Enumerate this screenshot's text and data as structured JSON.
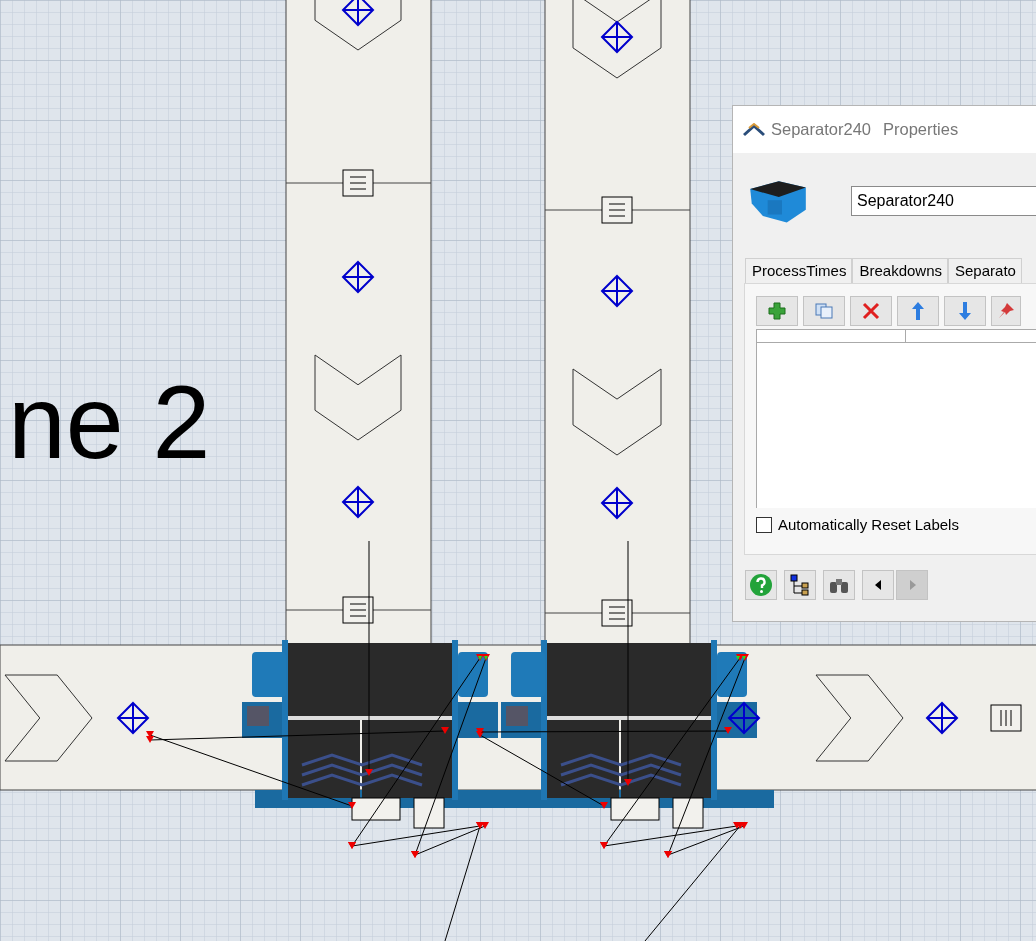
{
  "canvas": {
    "label": "ne 2"
  },
  "properties": {
    "title": "Separator240",
    "title_suffix": "Properties",
    "name_field": {
      "value": "Separator240"
    },
    "tabs": [
      {
        "label": "ProcessTimes",
        "selected": false
      },
      {
        "label": "Breakdowns",
        "selected": false
      },
      {
        "label": "Separato",
        "selected": false
      }
    ],
    "checkbox": {
      "label": "Automatically Reset Labels",
      "checked": false
    },
    "nav_buttons": [
      {
        "kind": "prev",
        "disabled": false
      },
      {
        "kind": "next",
        "disabled": true
      }
    ]
  }
}
